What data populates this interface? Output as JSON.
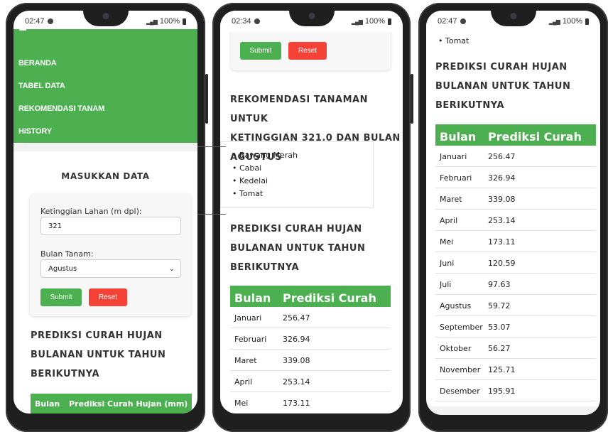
{
  "phones": [
    {
      "status": {
        "time": "02:47",
        "signal": "100%"
      },
      "nav": [
        "BERANDA",
        "TABEL DATA",
        "REKOMENDASI TANAM",
        "HISTORY"
      ],
      "form": {
        "title": "MASUKKAN DATA",
        "elevation_label": "Ketinggian Lahan (m dpl):",
        "elevation_value": "321",
        "month_label": "Bulan Tanam:",
        "month_value": "Agustus",
        "submit": "Submit",
        "reset": "Reset"
      },
      "prediction_title": [
        "PREDIKSI CURAH HUJAN",
        "BULANAN UNTUK TAHUN",
        "BERIKUTNYA"
      ],
      "table_header": [
        "Bulan",
        "Prediksi Curah Hujan (mm)"
      ]
    },
    {
      "status": {
        "time": "02:34",
        "signal": "100%"
      },
      "buttons": {
        "submit": "Submit",
        "reset": "Reset"
      },
      "rec_title": [
        "REKOMENDASI TANAMAN UNTUK",
        "KETINGGIAN 321.0 DAN BULAN",
        "AGUSTUS"
      ],
      "crops": [
        "Bawang Merah",
        "Cabai",
        "Kedelai",
        "Tomat"
      ],
      "prediction_title": [
        "PREDIKSI CURAH HUJAN",
        "BULANAN UNTUK TAHUN",
        "BERIKUTNYA"
      ],
      "table_header": [
        "Bulan",
        "Prediksi Curah Hujan (mm)"
      ],
      "rows": [
        [
          "Januari",
          "256.47"
        ],
        [
          "Februari",
          "326.94"
        ],
        [
          "Maret",
          "339.08"
        ],
        [
          "April",
          "253.14"
        ],
        [
          "Mei",
          "173.11"
        ]
      ]
    },
    {
      "status": {
        "time": "02:47",
        "signal": "100%"
      },
      "prev_item": "Tomat",
      "prediction_title": [
        "PREDIKSI CURAH HUJAN",
        "BULANAN UNTUK TAHUN",
        "BERIKUTNYA"
      ],
      "table_header": [
        "Bulan",
        "Prediksi Curah Hujan (mm)"
      ],
      "rows": [
        [
          "Januari",
          "256.47"
        ],
        [
          "Februari",
          "326.94"
        ],
        [
          "Maret",
          "339.08"
        ],
        [
          "April",
          "253.14"
        ],
        [
          "Mei",
          "173.11"
        ],
        [
          "Juni",
          "120.59"
        ],
        [
          "Juli",
          "97.63"
        ],
        [
          "Agustus",
          "59.72"
        ],
        [
          "September",
          "53.07"
        ],
        [
          "Oktober",
          "56.27"
        ],
        [
          "November",
          "125.71"
        ],
        [
          "Desember",
          "195.91"
        ]
      ]
    }
  ]
}
